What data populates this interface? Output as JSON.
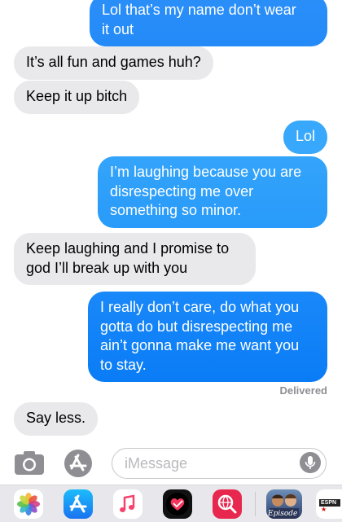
{
  "messages": [
    {
      "dir": "out",
      "lines": [
        "Lol that’s my name don’t wear",
        "it out"
      ]
    },
    {
      "dir": "in",
      "lines": [
        "It’s all fun and games huh?"
      ]
    },
    {
      "dir": "in",
      "lines": [
        "Keep it up bitch"
      ]
    },
    {
      "dir": "out",
      "lines": [
        "Lol"
      ]
    },
    {
      "dir": "out",
      "lines": [
        "I’m laughing because you are",
        "disrespecting me over",
        "something so minor."
      ]
    },
    {
      "dir": "in",
      "lines": [
        "Keep laughing and I promise to",
        "god I’ll break up with you"
      ]
    },
    {
      "dir": "out",
      "lines": [
        "I really don’t care, do what you",
        "gotta do but disrespecting me",
        "ain’t gonna make me want you",
        "to stay."
      ]
    },
    {
      "dir": "in",
      "lines": [
        "Say less."
      ]
    }
  ],
  "status": "Delivered",
  "composer": {
    "placeholder": "iMessage",
    "camera_icon": "camera-icon",
    "apps_icon": "app-store-icon",
    "mic_icon": "microphone-icon"
  },
  "colors": {
    "incoming_bubble": "#e9e9eb",
    "outgoing_top": "#34a4fb",
    "outgoing_bottom": "#0a7cf6",
    "dock_background": "#e8e8ec"
  },
  "dock_apps": [
    {
      "name": "Photos",
      "icon": "photos-icon"
    },
    {
      "name": "App Store",
      "icon": "app-store-icon"
    },
    {
      "name": "Music",
      "icon": "music-icon"
    },
    {
      "name": "Digital Touch",
      "icon": "heart-icon"
    },
    {
      "name": "Search Images",
      "icon": "globe-search-icon"
    },
    {
      "name": "Episode",
      "label": "Episode",
      "icon": "episode-icon"
    },
    {
      "name": "ESPN",
      "label": "ESPN",
      "icon": "espn-icon"
    }
  ]
}
